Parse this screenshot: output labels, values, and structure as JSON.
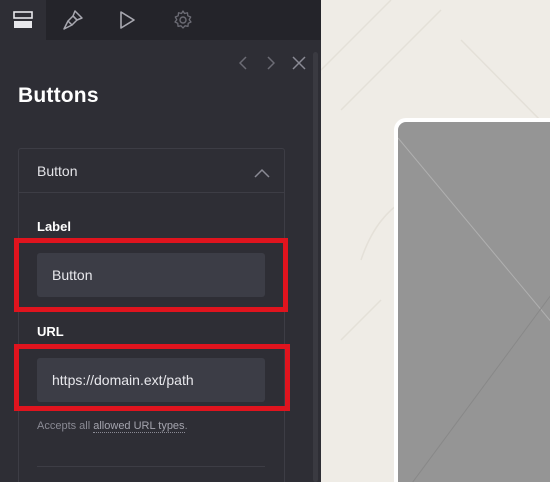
{
  "tabs": [
    {
      "icon": "layout-icon",
      "active": true
    },
    {
      "icon": "brush-icon",
      "active": false
    },
    {
      "icon": "play-icon",
      "active": false
    },
    {
      "icon": "gear-icon",
      "active": false
    }
  ],
  "panel": {
    "title": "Buttons",
    "card": {
      "header_label": "Button",
      "fields": {
        "label": {
          "label": "Label",
          "value": "Button"
        },
        "url": {
          "label": "URL",
          "value": "https://domain.ext/path"
        }
      },
      "help": {
        "prefix": "Accepts all ",
        "link": "allowed URL types",
        "suffix": "."
      }
    }
  },
  "colors": {
    "panel_bg": "#2e2e35",
    "highlight": "#e0141e",
    "canvas_bg": "#efece6",
    "preview_bg": "#959595"
  }
}
